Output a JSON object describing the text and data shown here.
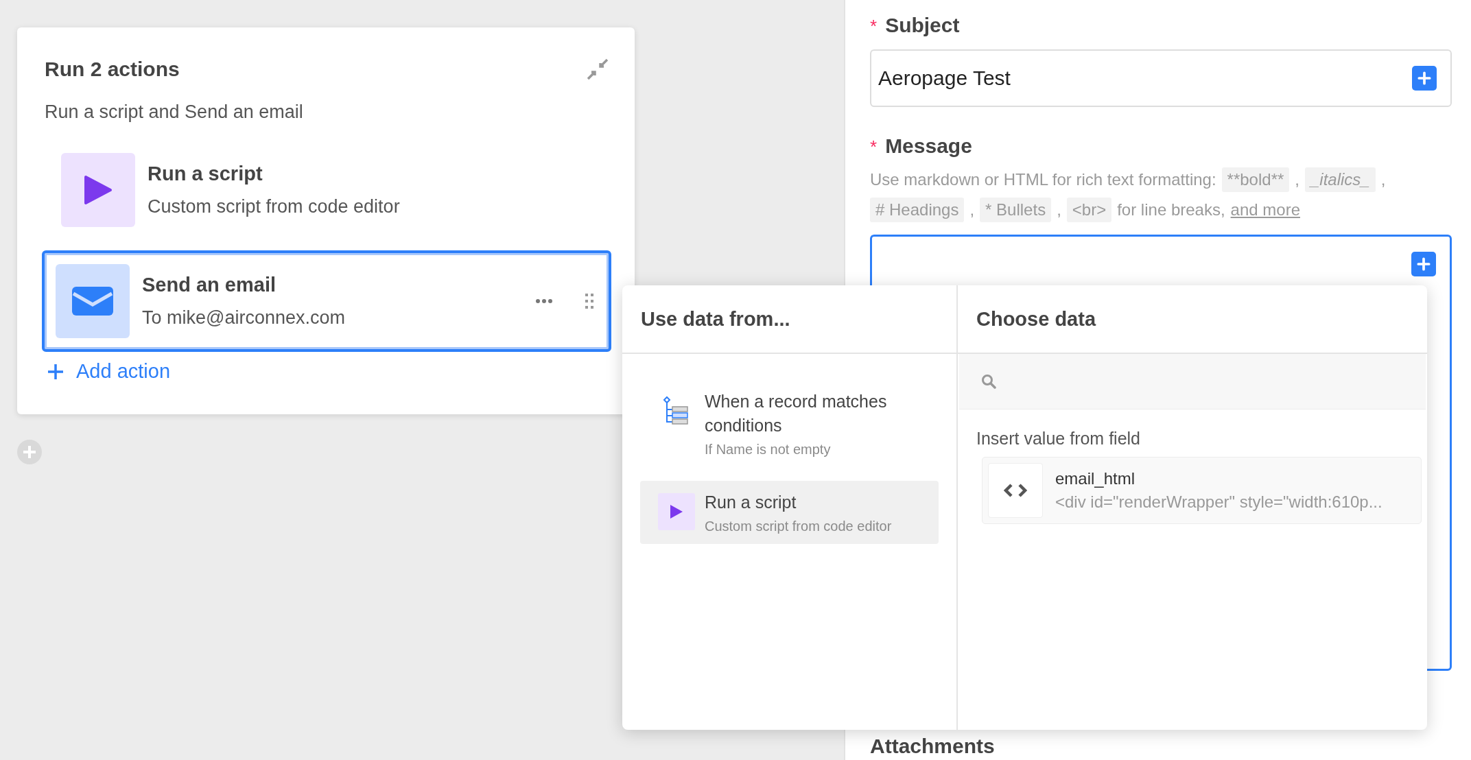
{
  "automation_card": {
    "title": "Run 2 actions",
    "subtitle": "Run a script and Send an email",
    "actions": [
      {
        "kind": "script",
        "title": "Run a script",
        "description": "Custom script from code editor",
        "selected": false
      },
      {
        "kind": "email",
        "title": "Send an email",
        "description": "To mike@airconnex.com",
        "selected": true
      }
    ],
    "add_action": "Add action"
  },
  "form": {
    "subject": {
      "marker": "*",
      "label": "Subject",
      "value": "Aeropage Test"
    },
    "message": {
      "marker": "*",
      "label": "Message",
      "help": [
        {
          "kind": "text",
          "text": "Use markdown or HTML for rich text formatting:"
        },
        {
          "kind": "code",
          "text": "**bold**"
        },
        {
          "kind": "text",
          "text": ","
        },
        {
          "kind": "code-italic",
          "text": "_italics_"
        },
        {
          "kind": "text",
          "text": ","
        },
        {
          "kind": "code",
          "text": "# Headings"
        },
        {
          "kind": "text",
          "text": ","
        },
        {
          "kind": "code",
          "text": "* Bullets"
        },
        {
          "kind": "text",
          "text": ","
        },
        {
          "kind": "code",
          "text": "<br>"
        },
        {
          "kind": "text",
          "text": "for line breaks,"
        },
        {
          "kind": "link",
          "text": "and more"
        }
      ]
    },
    "attachments_label": "Attachments"
  },
  "data_picker": {
    "left_title": "Use data from...",
    "right_title": "Choose data",
    "sources": [
      {
        "kind": "trigger",
        "title": "When a record matches conditions",
        "description": "If Name is not empty",
        "selected": false
      },
      {
        "kind": "script",
        "title": "Run a script",
        "description": "Custom script from code editor",
        "selected": true
      }
    ],
    "section_label": "Insert value from field",
    "fields": [
      {
        "name": "email_html",
        "preview": "<div id=\"renderWrapper\" style=\"width:610p..."
      }
    ]
  }
}
